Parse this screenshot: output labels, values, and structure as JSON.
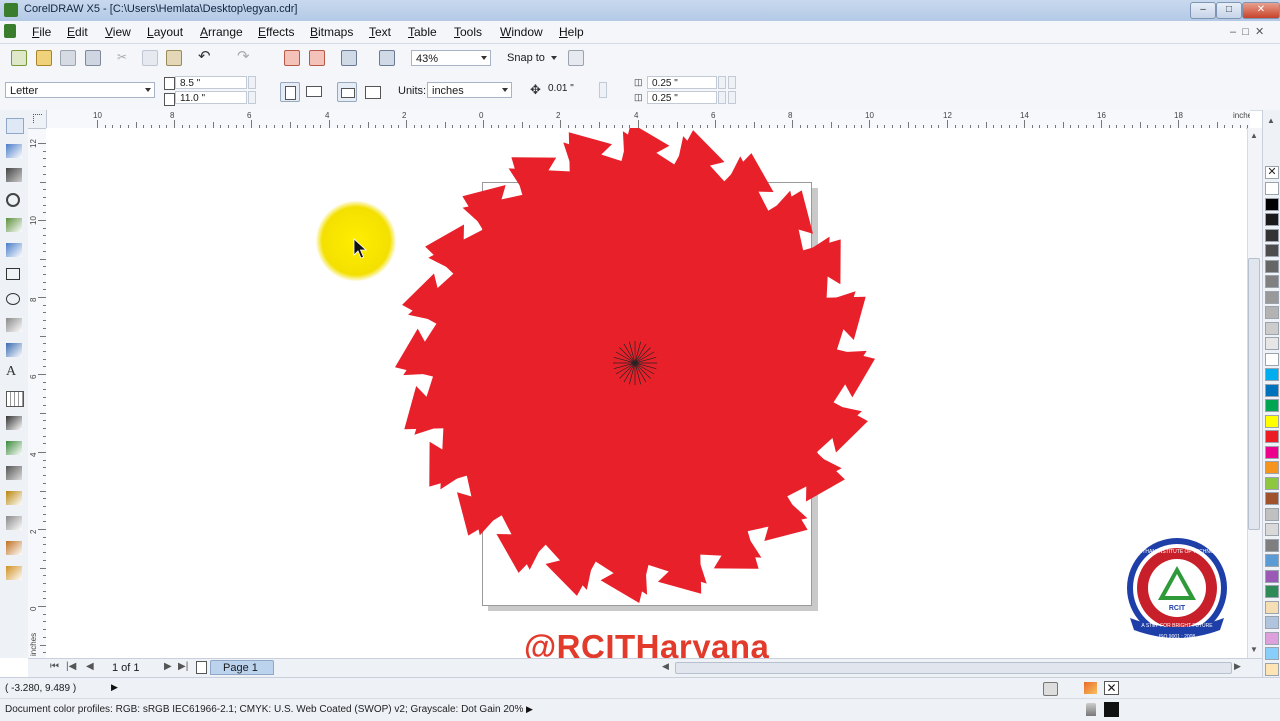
{
  "window": {
    "title": "CorelDRAW X5 - [C:\\Users\\Hemlata\\Desktop\\egyan.cdr]"
  },
  "menu": [
    "File",
    "Edit",
    "View",
    "Layout",
    "Arrange",
    "Effects",
    "Bitmaps",
    "Text",
    "Table",
    "Tools",
    "Window",
    "Help"
  ],
  "standard_toolbar": {
    "zoom": "43%",
    "snap_to": "Snap to"
  },
  "property_bar": {
    "paper": "Letter",
    "width": "8.5 \"",
    "height": "11.0 \"",
    "units_label": "Units:",
    "units_value": "inches",
    "nudge": "0.01 \"",
    "dup_x": "0.25 \"",
    "dup_y": "0.25 \""
  },
  "ruler": {
    "h_labels": [
      "10",
      "8",
      "6",
      "4",
      "2",
      "0",
      "2",
      "4",
      "6",
      "8",
      "10",
      "12",
      "14",
      "16",
      "18"
    ],
    "h_unit": "inches",
    "v_labels": [
      "12",
      "10",
      "8",
      "6",
      "4",
      "2",
      "0"
    ],
    "v_unit": "inches"
  },
  "navigator": {
    "page_count": "1 of 1",
    "page_tab": "Page 1"
  },
  "status": {
    "coords": "( -3.280, 9.489 )",
    "color_profiles": "Document color profiles: RGB: sRGB IEC61966-2.1; CMYK: U.S. Web Coated (SWOP) v2; Grayscale: Dot Gain 20%"
  },
  "watermark": "@RCITHaryana",
  "logo": {
    "top_text": "RAJASTHAN INSTITUTE OF TECHNOLOGY",
    "center_text": "RCIT",
    "ribbon": "A STEP FOR BRIGHT FUTURE",
    "iso": "ISO 9001 : 2008"
  },
  "artwork": {
    "fill": "#e8202a",
    "stroke": "#222222",
    "petal_count": 24
  },
  "palette": [
    "#ffffff",
    "#000000",
    "#1a1a1a",
    "#333333",
    "#4d4d4d",
    "#666666",
    "#808080",
    "#999999",
    "#b3b3b3",
    "#cccccc",
    "#e6e6e6",
    "#ffffff",
    "#00aeef",
    "#0072bc",
    "#00a651",
    "#ffff00",
    "#ed1c24",
    "#ec008c",
    "#f7941d",
    "#8dc63f",
    "#a0522d",
    "#c0c0c0",
    "#d9d9d9",
    "#7f7f7f",
    "#5b9bd5",
    "#9b59b6",
    "#2e8b57",
    "#f5deb3",
    "#b0c4de",
    "#dda0dd",
    "#87cefa",
    "#ffe4b5"
  ]
}
